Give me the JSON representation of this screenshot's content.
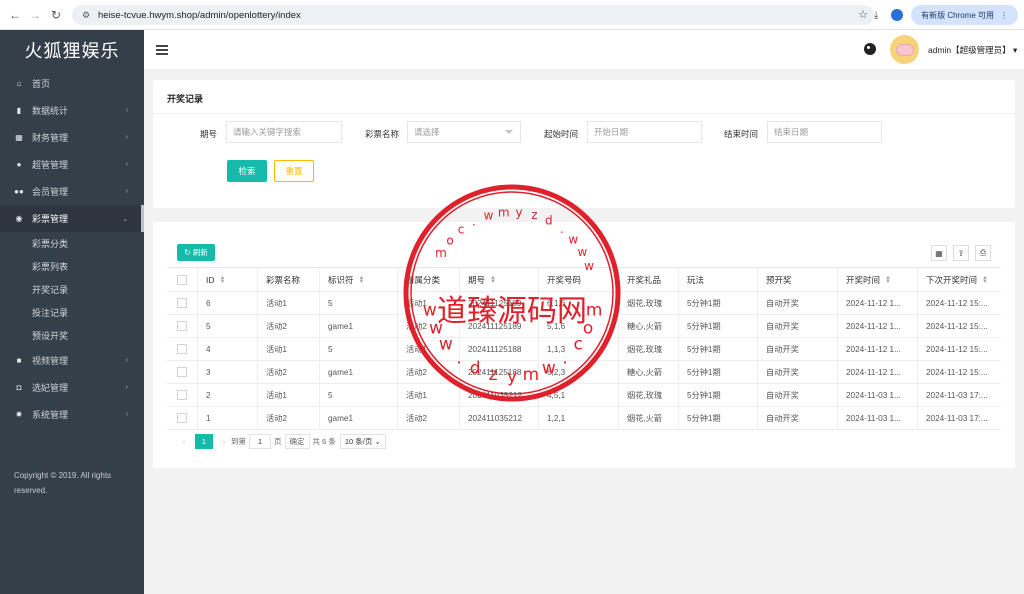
{
  "browser": {
    "url": "heise-tcvue.hwym.shop/admin/openlottery/index",
    "update_label": "有新版 Chrome 可用"
  },
  "sidebar": {
    "logo": "火狐狸娱乐",
    "items": [
      {
        "label": "首页",
        "icon": "home-icon"
      },
      {
        "label": "数据统计",
        "icon": "chart-icon"
      },
      {
        "label": "财务管理",
        "icon": "bank-icon"
      },
      {
        "label": "超管管理",
        "icon": "user-icon"
      },
      {
        "label": "会员管理",
        "icon": "users-icon"
      },
      {
        "label": "彩票管理",
        "icon": "gamepad-icon"
      },
      {
        "label": "视频管理",
        "icon": "video-icon"
      },
      {
        "label": "选妃管理",
        "icon": "camera-icon"
      },
      {
        "label": "系统管理",
        "icon": "gear-icon"
      }
    ],
    "submenu": [
      "彩票分类",
      "彩票列表",
      "开奖记录",
      "投注记录",
      "预设开奖"
    ],
    "copyright": "Copyright © 2019. All rights reserved."
  },
  "header": {
    "user": "admin【超级管理员】"
  },
  "filter": {
    "title": "开奖记录",
    "issue_label": "期号",
    "issue_placeholder": "请输入关键字搜索",
    "lottery_label": "彩票名称",
    "lottery_placeholder": "请选择",
    "start_label": "起始时间",
    "start_placeholder": "开始日期",
    "end_label": "结束时间",
    "end_placeholder": "结束日期",
    "search_button": "检索",
    "reset_button": "重置"
  },
  "table": {
    "refresh_button": "刷新",
    "columns": [
      "ID",
      "彩票名称",
      "标识符",
      "所属分类",
      "期号",
      "开奖号码",
      "开奖礼品",
      "玩法",
      "预开奖",
      "开奖时间",
      "下次开奖时间"
    ],
    "rows": [
      {
        "id": "6",
        "name": "活动1",
        "flag": "5",
        "cat": "活动1",
        "issue": "202411125189",
        "num": "6,1,6",
        "gift": "烟花,玫瑰",
        "play": "5分钟1期",
        "pre": "自动开奖",
        "time": "2024-11-12 1...",
        "next": "2024-11-12 15:..."
      },
      {
        "id": "5",
        "name": "活动2",
        "flag": "game1",
        "cat": "活动2",
        "issue": "202411125189",
        "num": "5,1,6",
        "gift": "糖心,火箭",
        "play": "5分钟1期",
        "pre": "自动开奖",
        "time": "2024-11-12 1...",
        "next": "2024-11-12 15:..."
      },
      {
        "id": "4",
        "name": "活动1",
        "flag": "5",
        "cat": "活动1",
        "issue": "202411125188",
        "num": "1,1,3",
        "gift": "烟花,玫瑰",
        "play": "5分钟1期",
        "pre": "自动开奖",
        "time": "2024-11-12 1...",
        "next": "2024-11-12 15:..."
      },
      {
        "id": "3",
        "name": "活动2",
        "flag": "game1",
        "cat": "活动2",
        "issue": "202411125188",
        "num": "6,2,3",
        "gift": "糖心,火箭",
        "play": "5分钟1期",
        "pre": "自动开奖",
        "time": "2024-11-12 1...",
        "next": "2024-11-12 15:..."
      },
      {
        "id": "2",
        "name": "活动1",
        "flag": "5",
        "cat": "活动1",
        "issue": "202411035212",
        "num": "4,5,1",
        "gift": "烟花,玫瑰",
        "play": "5分钟1期",
        "pre": "自动开奖",
        "time": "2024-11-03 1...",
        "next": "2024-11-03 17:..."
      },
      {
        "id": "1",
        "name": "活动2",
        "flag": "game1",
        "cat": "活动2",
        "issue": "202411035212",
        "num": "1,2,1",
        "gift": "烟花,火箭",
        "play": "5分钟1期",
        "pre": "自动开奖",
        "time": "2024-11-03 1...",
        "next": "2024-11-03 17:..."
      }
    ]
  },
  "pager": {
    "current": "1",
    "goto_label": "到第",
    "goto_value": "1",
    "page_unit": "页",
    "confirm": "确定",
    "total": "共 6 条",
    "per_page": "10 条/页"
  },
  "watermark": {
    "main_text": "道臻源码网",
    "letters_top": [
      "w",
      "w",
      "w",
      ".",
      "d",
      "z",
      "y",
      "m",
      "w",
      ".",
      "c",
      "o",
      "m"
    ],
    "letters_bottom": [
      "w",
      "w",
      "w",
      ".",
      "d",
      "z",
      "y",
      "m",
      "w",
      ".",
      "c",
      "o",
      "m"
    ],
    "color": "#e0202a"
  }
}
